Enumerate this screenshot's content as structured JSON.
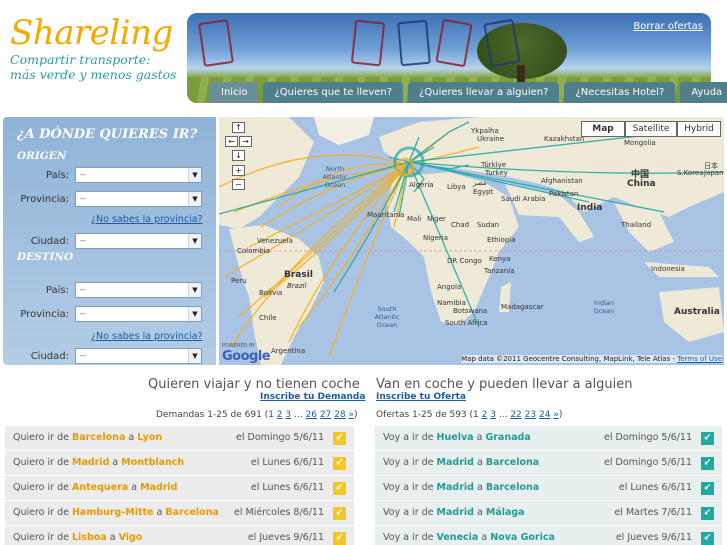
{
  "brand": {
    "name": "Shareling",
    "tagline_1": "Compartir transporte:",
    "tagline_2": "más verde y menos gastos"
  },
  "header": {
    "borrar_ofertas": "Borrar ofertas",
    "nav": [
      "Inicio",
      "¿Quieres que te lleven?",
      "¿Quieres llevar a alguien?",
      "¿Necesitas Hotel?",
      "Ayuda"
    ],
    "active_nav": "Inicio"
  },
  "search": {
    "title": "¿A DÓNDE QUIERES IR?",
    "origen": {
      "heading": "ORIGEN",
      "pais_label": "País:",
      "pais_value": "--",
      "provincia_label": "Provincia:",
      "provincia_value": "--",
      "help": "¿No sabes la provincia?",
      "ciudad_label": "Ciudad:",
      "ciudad_value": "--"
    },
    "destino": {
      "heading": "DESTINO",
      "pais_label": "País:",
      "pais_value": "--",
      "provincia_label": "Provincia:",
      "provincia_value": "--",
      "help": "¿No sabes la provincia?",
      "ciudad_label": "Ciudad:",
      "ciudad_value": "--"
    }
  },
  "map": {
    "types": [
      "Map",
      "Satellite",
      "Hybrid"
    ],
    "active_type": "Map",
    "controls": {
      "up": "↑",
      "left": "←",
      "right": "→",
      "down": "↓",
      "zoom_in": "+",
      "zoom_out": "−"
    },
    "labels": {
      "ukraine": "Ykpaïha",
      "ukraine_sub": "Ukraine",
      "kazakhstan": "Kazakhstan",
      "mongolia": "Mongolia",
      "turkey": "Türkiye",
      "turkey_sub": "Turkey",
      "japan": "日本",
      "japan_sub": "Japan",
      "korea": "S.Korea",
      "china_cn": "中国",
      "china": "China",
      "afghanistan": "Afghanistan",
      "pakistan": "Pakistan",
      "india": "India",
      "thailand": "Thailand",
      "algeria": "Algeria",
      "libya": "Libya",
      "egypt": "مصر",
      "egypt_sub": "Egypt",
      "saudi": "Saudi Arabia",
      "mauritania": "Mauritania",
      "mali": "Mali",
      "niger": "Niger",
      "chad": "Chad",
      "sudan": "Sudan",
      "nigeria": "Nigeria",
      "ethiopia": "Ethiopia",
      "drc": "DR Congo",
      "kenya": "Kenya",
      "tanzania": "Tanzania",
      "angola": "Angola",
      "namibia": "Namibia",
      "botswana": "Botswana",
      "madagascar": "Madagascar",
      "south_africa": "South Africa",
      "indonesia": "Indonesia",
      "australia": "Australia",
      "venezuela": "Venezuela",
      "colombia": "Colombia",
      "peru": "Peru",
      "brasil": "Brasil",
      "brazil": "Brazil",
      "bolivia": "Bolivia",
      "chile": "Chile",
      "argentina": "Argentina",
      "north_atlantic": "North Atlantic Ocean",
      "south_atlantic": "South Atlantic Ocean",
      "indian_ocean": "Indian Ocean"
    },
    "powered_by": "POWERED BY",
    "google": "Google",
    "attribution": "Map data ©2011 Geocentre Consulting, MapLink, Tele Atlas - ",
    "terms": "Terms of Use",
    "colors": {
      "demand_routes": "#f5b01c",
      "offer_routes": "#20a9a3"
    }
  },
  "demands": {
    "title": "Quieren viajar y no tienen coche",
    "signup": "Inscribe tu Demanda",
    "range": "Demandas 1-25 de 691 (",
    "pages": [
      "1",
      "2",
      "3",
      "...",
      "26",
      "27",
      "28",
      "»"
    ],
    "close": ")",
    "rows": [
      {
        "prefix": "Quiero ir de",
        "from": "Barcelona",
        "sep": "a",
        "to": "Lyon",
        "date": "el Domingo 5/6/11"
      },
      {
        "prefix": "Quiero ir de",
        "from": "Madrid",
        "sep": "a",
        "to": "Montblanch",
        "date": "el Lunes 6/6/11"
      },
      {
        "prefix": "Quiero ir de",
        "from": "Antequera",
        "sep": "a",
        "to": "Madrid",
        "date": "el Lunes 6/6/11"
      },
      {
        "prefix": "Quiero ir de",
        "from": "Hamburg-Mitte",
        "sep": "a",
        "to": "Barcelona",
        "date": "el Miércoles 8/6/11"
      },
      {
        "prefix": "Quiero ir de",
        "from": "Lisboa",
        "sep": "a",
        "to": "Vigo",
        "date": "el Jueves 9/6/11"
      }
    ]
  },
  "offers": {
    "title": "Van en coche y pueden llevar a alguien",
    "signup": "Inscribe tu Oferta",
    "range": "Ofertas 1-25 de 593 (",
    "pages": [
      "1",
      "2",
      "3",
      "...",
      "22",
      "23",
      "24",
      "»"
    ],
    "close": ")",
    "rows": [
      {
        "prefix": "Voy a ir de",
        "from": "Huelva",
        "sep": "a",
        "to": "Granada",
        "date": "el Domingo 5/6/11"
      },
      {
        "prefix": "Voy a ir de",
        "from": "Madrid",
        "sep": "a",
        "to": "Barcelona",
        "date": "el Domingo 5/6/11"
      },
      {
        "prefix": "Voy a ir de",
        "from": "Madrid",
        "sep": "a",
        "to": "Barcelona",
        "date": "el Lunes 6/6/11"
      },
      {
        "prefix": "Voy a ir de",
        "from": "Madrid",
        "sep": "a",
        "to": "Málaga",
        "date": "el Martes 7/6/11"
      },
      {
        "prefix": "Voy a ir de",
        "from": "Venecia",
        "sep": "a",
        "to": "Nova Gorica",
        "date": "el Jueves 9/6/11"
      }
    ]
  }
}
